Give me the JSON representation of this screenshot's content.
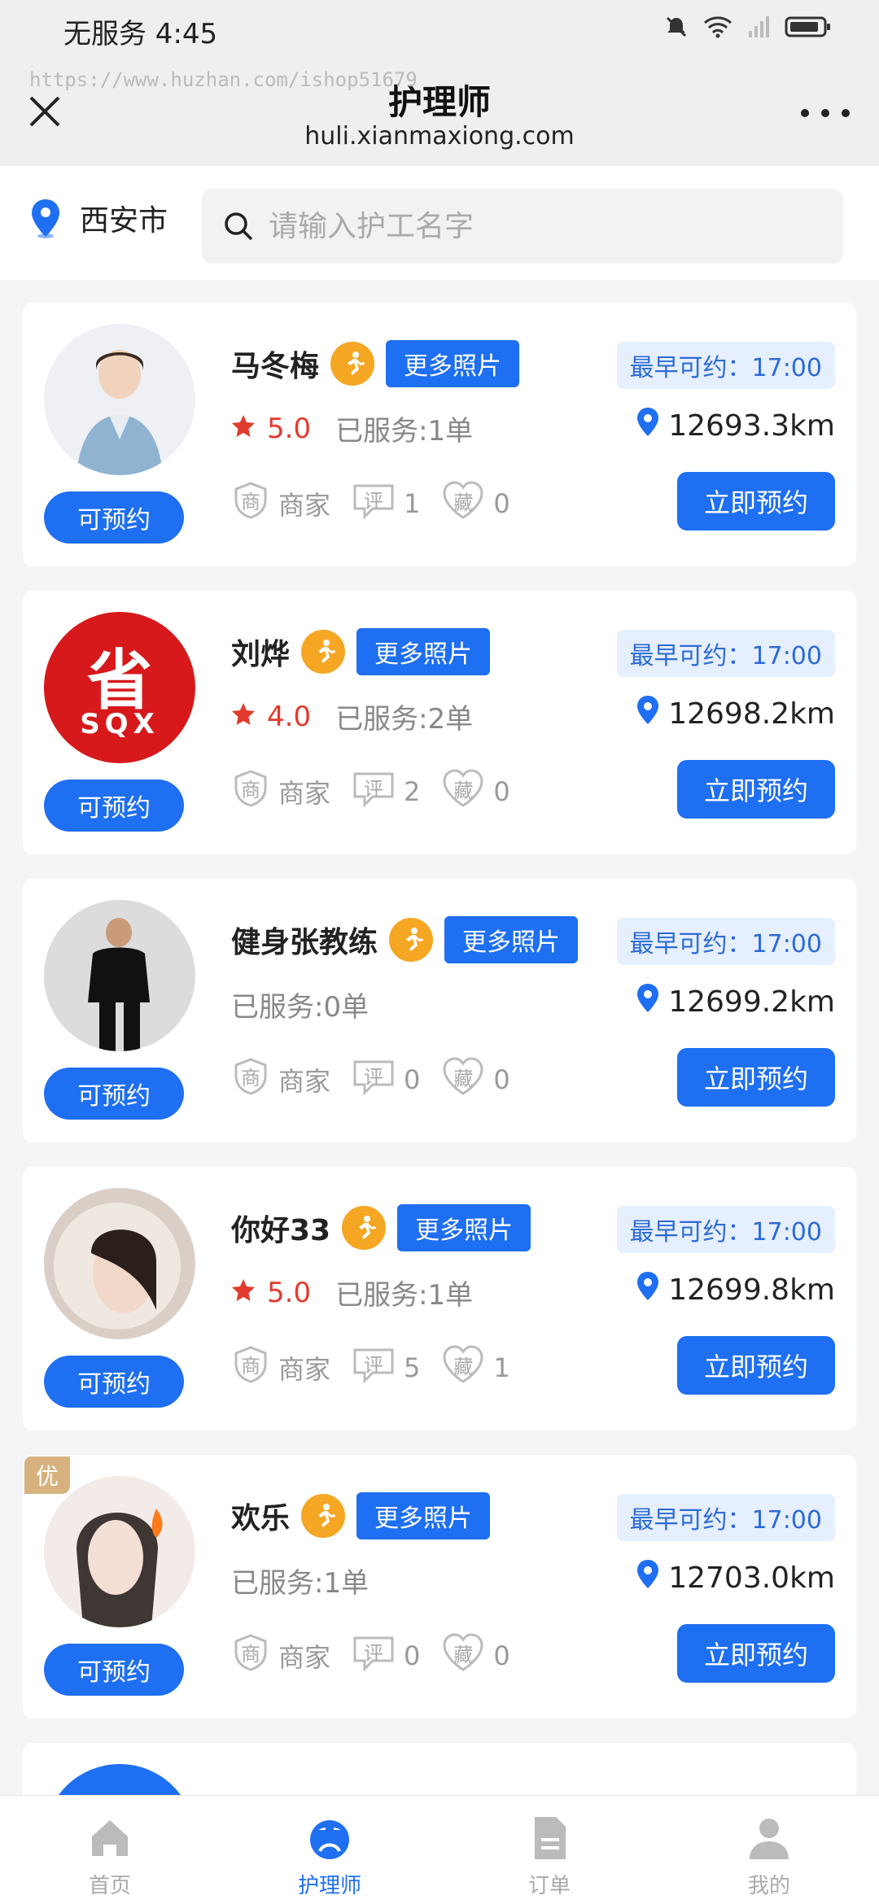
{
  "status_bar": {
    "carrier_time": "无服务 4:45"
  },
  "watermark": "https://www.huzhan.com/ishop51679",
  "header": {
    "title": "护理师",
    "url": "huli.xianmaxiong.com"
  },
  "location": {
    "city": "西安市"
  },
  "search": {
    "placeholder": "请输入护工名字"
  },
  "labels": {
    "available": "可预约",
    "more_photos": "更多照片",
    "earliest": "最早可约：17:00",
    "book_now": "立即预约",
    "merchant": "商家",
    "review_char": "评",
    "favorite_char": "藏",
    "merchant_char": "商",
    "premium_badge": "优"
  },
  "colors": {
    "accent": "#1e6ff1",
    "rating": "#e23a2d",
    "run_badge": "#f5a623"
  },
  "caregivers": [
    {
      "name": "马冬梅",
      "rating": "5.0",
      "served": "已服务:1单",
      "distance": "12693.3km",
      "reviews": "1",
      "favorites": "0",
      "avatar": "avatar-woman-uniform"
    },
    {
      "name": "刘烨",
      "rating": "4.0",
      "served": "已服务:2单",
      "distance": "12698.2km",
      "reviews": "2",
      "favorites": "0",
      "avatar": "avatar-logo-sqx",
      "logo_text": "省",
      "logo_sub": "SQX"
    },
    {
      "name": "健身张教练",
      "rating": "",
      "served": "已服务:0单",
      "distance": "12699.2km",
      "reviews": "0",
      "favorites": "0",
      "avatar": "avatar-fitness"
    },
    {
      "name": "你好33",
      "rating": "5.0",
      "served": "已服务:1单",
      "distance": "12699.8km",
      "reviews": "5",
      "favorites": "1",
      "avatar": "avatar-girl-hood"
    },
    {
      "name": "欢乐",
      "rating": "",
      "served": "已服务:1单",
      "distance": "12703.0km",
      "reviews": "0",
      "favorites": "0",
      "avatar": "avatar-girl-flame",
      "premium": true
    }
  ],
  "bottom_nav": [
    {
      "label": "首页",
      "icon": "home-icon"
    },
    {
      "label": "护理师",
      "icon": "nurse-icon",
      "active": true
    },
    {
      "label": "订单",
      "icon": "order-icon"
    },
    {
      "label": "我的",
      "icon": "profile-icon"
    }
  ]
}
